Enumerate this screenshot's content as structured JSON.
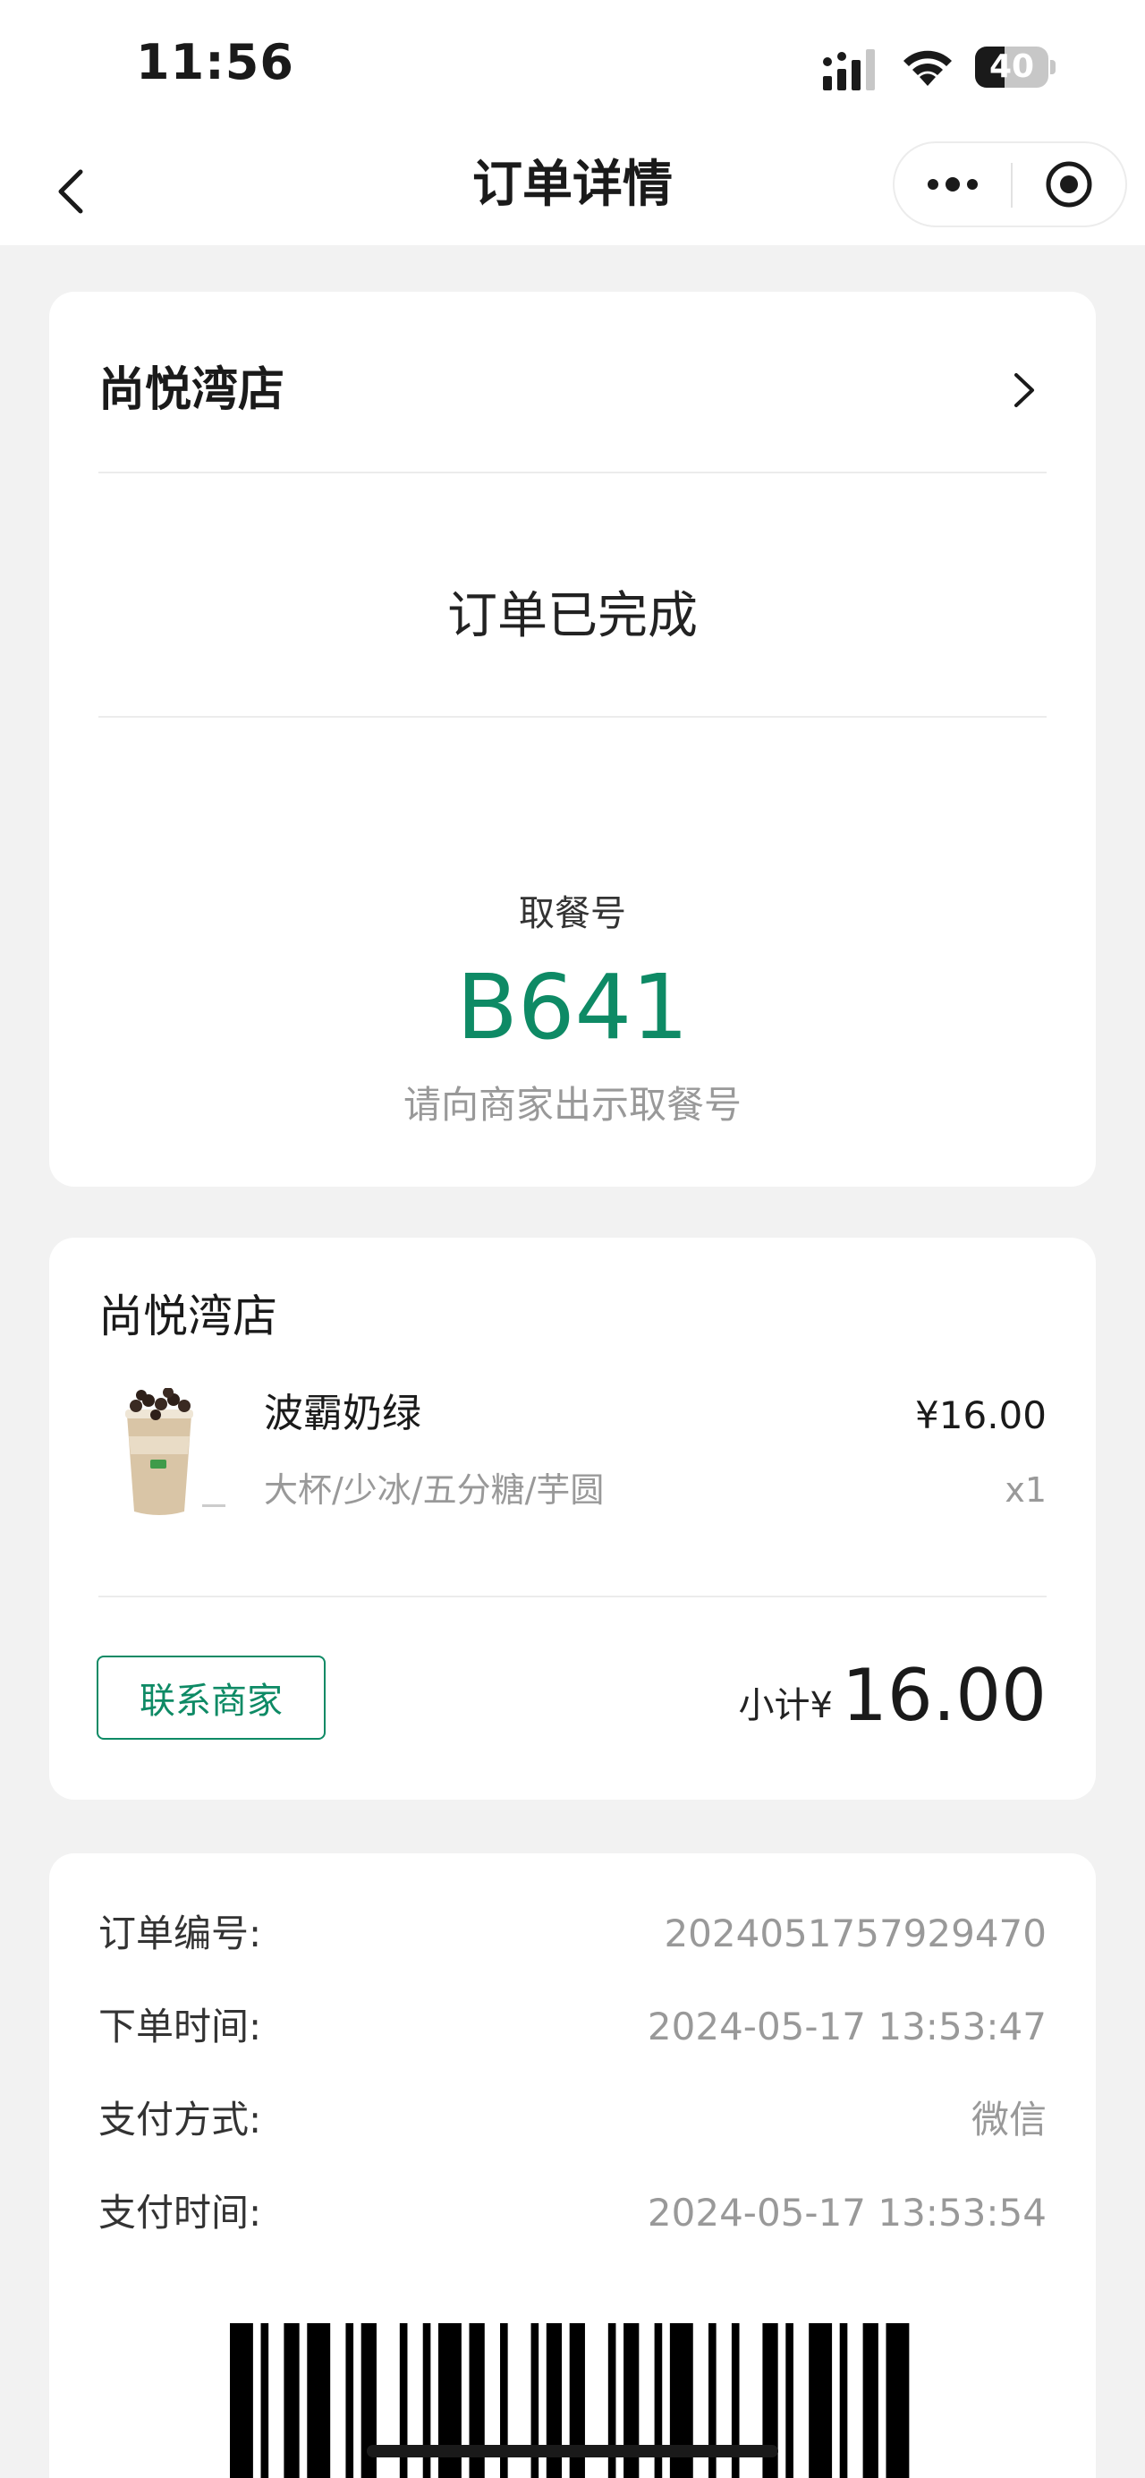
{
  "status_bar": {
    "time": "11:56",
    "battery_level": "40",
    "battery_fraction": 0.4
  },
  "nav": {
    "title": "订单详情",
    "more_icon": "more-dots-icon",
    "close_icon": "target-circle-icon",
    "back_icon": "chevron-left-icon"
  },
  "order_status": {
    "store_name": "尚悦湾店",
    "status": "订单已完成",
    "pickup_label": "取餐号",
    "pickup_number": "B641",
    "pickup_hint": "请向商家出示取餐号"
  },
  "order_items": {
    "store_name": "尚悦湾店",
    "items": [
      {
        "name": "波霸奶绿",
        "spec": "大杯/少冰/五分糖/芋圆",
        "price": "¥16.00",
        "qty": "x1"
      }
    ],
    "contact_label": "联系商家",
    "subtotal_label": "小计¥",
    "subtotal_value": "16.00"
  },
  "order_info": {
    "rows": [
      {
        "label": "订单编号:",
        "value": "2024051757929470"
      },
      {
        "label": "下单时间:",
        "value": "2024-05-17 13:53:47"
      },
      {
        "label": "支付方式:",
        "value": "微信"
      },
      {
        "label": "支付时间:",
        "value": "2024-05-17 13:53:54"
      }
    ]
  },
  "colors": {
    "accent": "#0e8a65",
    "background": "#f2f2f2",
    "muted": "#999999"
  }
}
